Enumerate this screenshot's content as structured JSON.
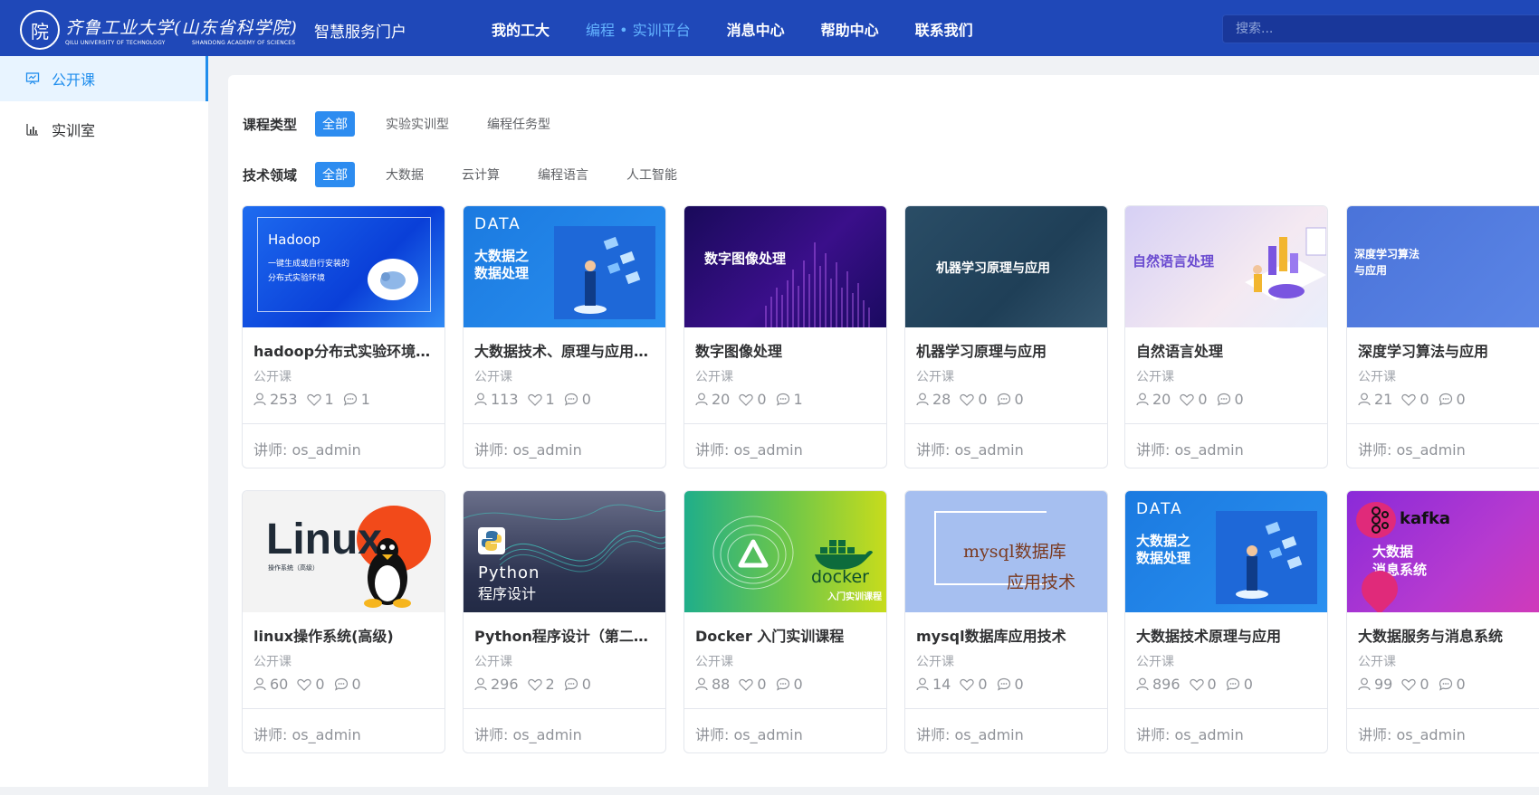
{
  "header": {
    "logo_seal": "院",
    "logo_cn": "齐鲁工业大学(山东省科学院)",
    "logo_en_left": "QILU UNIVERSITY OF TECHNOLOGY",
    "logo_en_right": "SHANDONG ACADEMY OF SCIENCES",
    "portal_name": "智慧服务门户",
    "nav": [
      {
        "label": "我的工大"
      },
      {
        "label": "编程 • 实训平台"
      },
      {
        "label": "消息中心"
      },
      {
        "label": "帮助中心"
      },
      {
        "label": "联系我们"
      }
    ],
    "search_placeholder": "搜索..."
  },
  "sidebar": {
    "items": [
      {
        "label": "公开课",
        "icon": "presentation-icon"
      },
      {
        "label": "实训室",
        "icon": "bar-chart-icon"
      }
    ]
  },
  "filters": {
    "course_type": {
      "label": "课程类型",
      "options": [
        "全部",
        "实验实训型",
        "编程任务型"
      ]
    },
    "tech_field": {
      "label": "技术领域",
      "options": [
        "全部",
        "大数据",
        "云计算",
        "编程语言",
        "人工智能"
      ]
    }
  },
  "courses": [
    {
      "title": "hadoop分布式实验环境搭建",
      "type": "公开课",
      "students": "253",
      "likes": "1",
      "comments": "1",
      "teacher": "讲师: os_admin",
      "cover": {
        "line1": "Hadoop",
        "line2": "一键生成或自行安装的",
        "line3": "分布式实验环境"
      }
    },
    {
      "title": "大数据技术、原理与应用（第二版）",
      "type": "公开课",
      "students": "113",
      "likes": "1",
      "comments": "0",
      "teacher": "讲师: os_admin",
      "cover": {
        "line1": "DATA",
        "line2": "大数据之",
        "line3": "数据处理"
      }
    },
    {
      "title": "数字图像处理",
      "type": "公开课",
      "students": "20",
      "likes": "0",
      "comments": "1",
      "teacher": "讲师: os_admin",
      "cover": {
        "line1": "数字图像处理"
      }
    },
    {
      "title": "机器学习原理与应用",
      "type": "公开课",
      "students": "28",
      "likes": "0",
      "comments": "0",
      "teacher": "讲师: os_admin",
      "cover": {
        "line1": "机器学习原理与应用"
      }
    },
    {
      "title": "自然语言处理",
      "type": "公开课",
      "students": "20",
      "likes": "0",
      "comments": "0",
      "teacher": "讲师: os_admin",
      "cover": {
        "line1": "自然语言处理"
      }
    },
    {
      "title": "深度学习算法与应用",
      "type": "公开课",
      "students": "21",
      "likes": "0",
      "comments": "0",
      "teacher": "讲师: os_admin",
      "cover": {
        "line1": "深度学习算法",
        "line2": "与应用"
      }
    },
    {
      "title": "linux操作系统(高级)",
      "type": "公开课",
      "students": "60",
      "likes": "0",
      "comments": "0",
      "teacher": "讲师: os_admin",
      "cover": {
        "line1": "Linux",
        "line2": "操作系统（高级）"
      }
    },
    {
      "title": "Python程序设计（第二版）",
      "type": "公开课",
      "students": "296",
      "likes": "2",
      "comments": "0",
      "teacher": "讲师: os_admin",
      "cover": {
        "line1": "Python",
        "line2": "程序设计"
      }
    },
    {
      "title": "Docker 入门实训课程",
      "type": "公开课",
      "students": "88",
      "likes": "0",
      "comments": "0",
      "teacher": "讲师: os_admin",
      "cover": {
        "line1": "docker",
        "line2": "入门实训课程"
      }
    },
    {
      "title": "mysql数据库应用技术",
      "type": "公开课",
      "students": "14",
      "likes": "0",
      "comments": "0",
      "teacher": "讲师: os_admin",
      "cover": {
        "line1": "mysql数据库",
        "line2": "应用技术"
      }
    },
    {
      "title": "大数据技术原理与应用",
      "type": "公开课",
      "students": "896",
      "likes": "0",
      "comments": "0",
      "teacher": "讲师: os_admin",
      "cover": {
        "line1": "DATA",
        "line2": "大数据之",
        "line3": "数据处理"
      }
    },
    {
      "title": "大数据服务与消息系统",
      "type": "公开课",
      "students": "99",
      "likes": "0",
      "comments": "0",
      "teacher": "讲师: os_admin",
      "cover": {
        "line1": "kafka",
        "line2": "大数据",
        "line3": "消息系统"
      }
    }
  ],
  "colors": {
    "header_bg": "#1f48b8",
    "accent": "#2d8cf0",
    "nav_active": "#63b3ff"
  }
}
